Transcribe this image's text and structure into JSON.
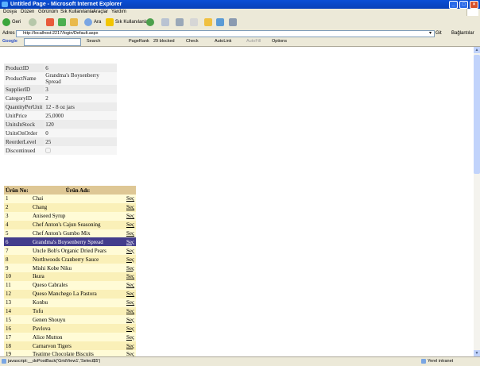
{
  "window": {
    "title": "Untitled Page - Microsoft Internet Explorer",
    "minimize": "_",
    "maximize": "□",
    "close": "×"
  },
  "menu": [
    "Dosya",
    "Düzen",
    "Görünüm",
    "Sık Kullanılanlar",
    "Araçlar",
    "Yardım"
  ],
  "toolbar": {
    "back_label": "Geri",
    "search_label": "Ara",
    "favorites_label": "Sık Kullanılanlar"
  },
  "address": {
    "label": "Adres",
    "url": "http://localhost:2217/login/Default.aspx",
    "go_label": "Git",
    "links_label": "Bağlantılar"
  },
  "googlebar": {
    "logo": "Google",
    "search_label": "Search",
    "pagerank_label": "PageRank",
    "blocked_label": "29 blocked",
    "check_label": "Check",
    "autolink_label": "AutoLink",
    "autofill_label": "AutoFill",
    "options_label": "Options"
  },
  "details": [
    {
      "key": "ProductID",
      "value": "6"
    },
    {
      "key": "ProductName",
      "value": "Grandma's Boysenberry Spread"
    },
    {
      "key": "SupplierID",
      "value": "3"
    },
    {
      "key": "CategoryID",
      "value": "2"
    },
    {
      "key": "QuantityPerUnit",
      "value": "12 - 8 oz jars"
    },
    {
      "key": "UnitPrice",
      "value": "25,0000"
    },
    {
      "key": "UnitsInStock",
      "value": "120"
    },
    {
      "key": "UnitsOnOrder",
      "value": "0"
    },
    {
      "key": "ReorderLevel",
      "value": "25"
    },
    {
      "key": "Discontinued",
      "value": ""
    }
  ],
  "grid": {
    "headers": {
      "no": "Ürün No:",
      "name": "Ürün Adı:"
    },
    "select_label": "Seç",
    "selected_index": 5,
    "rows": [
      {
        "no": "1",
        "name": "Chai"
      },
      {
        "no": "2",
        "name": "Chang"
      },
      {
        "no": "3",
        "name": "Aniseed Syrup"
      },
      {
        "no": "4",
        "name": "Chef Anton's Cajun Seasoning"
      },
      {
        "no": "5",
        "name": "Chef Anton's Gumbo Mix"
      },
      {
        "no": "6",
        "name": "Grandma's Boysenberry Spread"
      },
      {
        "no": "7",
        "name": "Uncle Bob's Organic Dried Pears"
      },
      {
        "no": "8",
        "name": "Northwoods Cranberry Sauce"
      },
      {
        "no": "9",
        "name": "Mishi Kobe Niku"
      },
      {
        "no": "10",
        "name": "Ikura"
      },
      {
        "no": "11",
        "name": "Queso Cabrales"
      },
      {
        "no": "12",
        "name": "Queso Manchego La Pastora"
      },
      {
        "no": "13",
        "name": "Konbu"
      },
      {
        "no": "14",
        "name": "Tofu"
      },
      {
        "no": "15",
        "name": "Genen Shouyu"
      },
      {
        "no": "16",
        "name": "Pavlova"
      },
      {
        "no": "17",
        "name": "Alice Mutton"
      },
      {
        "no": "18",
        "name": "Carnarvon Tigers"
      },
      {
        "no": "19",
        "name": "Teatime Chocolate Biscuits"
      }
    ]
  },
  "status": {
    "text": "javascript:__doPostBack('GridView1','Select$5')",
    "zone": "Yerel intranet"
  }
}
